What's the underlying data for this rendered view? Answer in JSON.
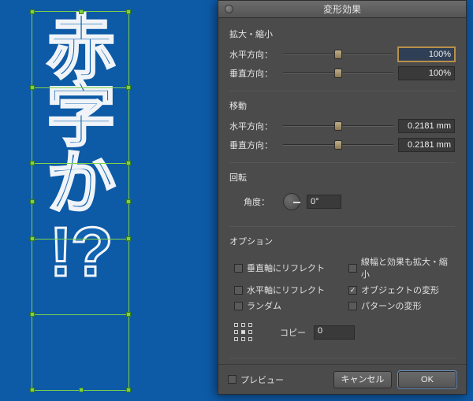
{
  "artwork": {
    "glyphs": [
      "赤",
      "字",
      "か",
      "!?"
    ]
  },
  "dialog": {
    "title": "変形効果",
    "sections": {
      "scale": {
        "label": "拡大・縮小",
        "horizontal": {
          "label": "水平方向：",
          "value": "100%",
          "thumb_pct": 50
        },
        "vertical": {
          "label": "垂直方向：",
          "value": "100%",
          "thumb_pct": 50
        }
      },
      "move": {
        "label": "移動",
        "horizontal": {
          "label": "水平方向：",
          "value": "0.2181 mm",
          "thumb_pct": 50
        },
        "vertical": {
          "label": "垂直方向：",
          "value": "0.2181 mm",
          "thumb_pct": 50
        }
      },
      "rotate": {
        "label": "回転",
        "angle_label": "角度：",
        "angle_value": "0°"
      },
      "options": {
        "label": "オプション",
        "checks": [
          {
            "label": "垂直軸にリフレクト",
            "checked": false
          },
          {
            "label": "線幅と効果も拡大・縮小",
            "checked": false
          },
          {
            "label": "水平軸にリフレクト",
            "checked": false
          },
          {
            "label": "オブジェクトの変形",
            "checked": true
          },
          {
            "label": "ランダム",
            "checked": false
          },
          {
            "label": "パターンの変形",
            "checked": false
          }
        ]
      },
      "copies": {
        "label": "コピー",
        "value": "0"
      }
    },
    "footer": {
      "preview": {
        "label": "プレビュー",
        "checked": false
      },
      "cancel": "キャンセル",
      "ok": "OK"
    }
  }
}
